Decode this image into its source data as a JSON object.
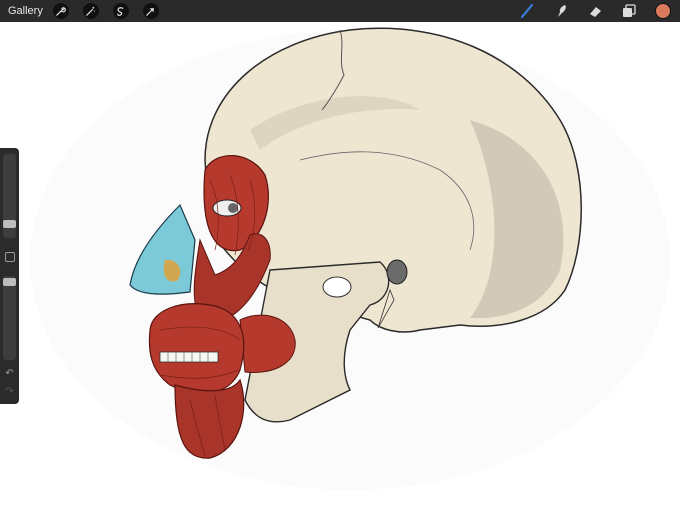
{
  "topbar": {
    "gallery_label": "Gallery",
    "left_tools": [
      "wrench-icon",
      "magic-wand-icon",
      "selection-icon",
      "transform-arrow-icon"
    ],
    "right_tools": [
      "brush-icon",
      "smudge-icon",
      "eraser-icon",
      "layers-icon"
    ],
    "current_color": "#d97a5c",
    "brush_color": "#3a7bd5"
  },
  "sidebar": {
    "brush_size_level": 0.7,
    "opacity_level": 0.05
  },
  "canvas": {
    "skull_color": "#efe6d2",
    "muscle_color": "#b5392c",
    "cartilage_color": "#7cc9d8"
  }
}
